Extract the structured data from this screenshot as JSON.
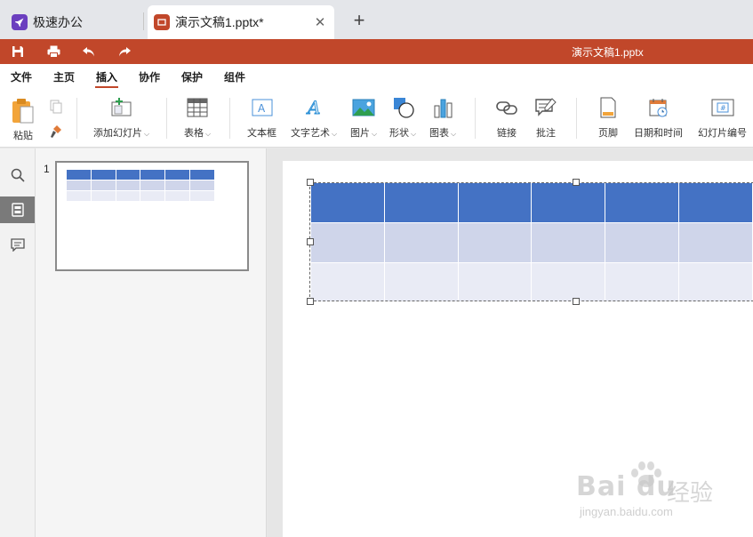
{
  "tabs": {
    "home_label": "极速办公",
    "doc_label": "演示文稿1.pptx*",
    "close_glyph": "✕",
    "new_tab_glyph": "+"
  },
  "titlebar": {
    "document_title": "演示文稿1.pptx",
    "accent_color": "#c1472a"
  },
  "menu": {
    "items": [
      "文件",
      "主页",
      "插入",
      "协作",
      "保护",
      "组件"
    ],
    "active": "插入"
  },
  "ribbon": {
    "paste": "粘贴",
    "add_slide": "添加幻灯片",
    "table": "表格",
    "textbox": "文本框",
    "text_art": "文字艺术",
    "picture": "图片",
    "shape": "形状",
    "chart": "图表",
    "link": "链接",
    "comment": "批注",
    "footer": "页脚",
    "datetime": "日期和时间",
    "slide_number": "幻灯片编号",
    "caret": "⌵"
  },
  "thumbnails": {
    "slide_number": "1"
  },
  "colors": {
    "table_header": "#4472c4",
    "table_row_1": "#cfd5ea",
    "table_row_2": "#e9ebf5"
  },
  "watermark": {
    "brand": "Bai du",
    "brand_cn": "经验",
    "url": "jingyan.baidu.com"
  }
}
